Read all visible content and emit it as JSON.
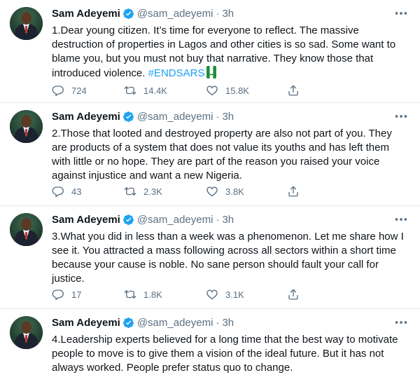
{
  "tweets": [
    {
      "name": "Sam Adeyemi",
      "handle": "@sam_adeyemi",
      "dot": "·",
      "time": "3h",
      "text": "1.Dear young citizen. It’s time for everyone to reflect. The massive destruction of properties in Lagos and other cities is so sad. Some want to blame you, but you must not buy that narrative. They know those that introduced violence.",
      "hashtag": "#ENDSARS",
      "replies": "724",
      "retweets": "14.4K",
      "likes": "15.8K"
    },
    {
      "name": "Sam Adeyemi",
      "handle": "@sam_adeyemi",
      "dot": "·",
      "time": "3h",
      "text": "2.Those that looted and destroyed property are also not part of you. They are products of a system that does not value its youths and has left them with little or no hope. They are part of the reason you raised your voice against injustice and want a new Nigeria.",
      "replies": "43",
      "retweets": "2.3K",
      "likes": "3.8K"
    },
    {
      "name": "Sam Adeyemi",
      "handle": "@sam_adeyemi",
      "dot": "·",
      "time": "3h",
      "text": "3.What you did in less than a week was a phenomenon. Let me share how I see it. You attracted a mass following across all sectors within a short time because your cause is noble. No sane person should fault your call for justice.",
      "replies": "17",
      "retweets": "1.8K",
      "likes": "3.1K"
    },
    {
      "name": "Sam Adeyemi",
      "handle": "@sam_adeyemi",
      "dot": "·",
      "time": "3h",
      "text": "4.Leadership experts believed for a long time that the best way to motivate people to move is to give them a vision of the ideal future. But it has not always worked. People prefer status quo to change."
    }
  ],
  "colors": {
    "accent": "#1da1f2",
    "muted": "#5b7083",
    "text": "#0f1419",
    "divider": "#e6ecf0"
  },
  "icons": [
    "verified-badge-icon",
    "more-options-icon",
    "reply-icon",
    "retweet-icon",
    "like-icon",
    "share-icon",
    "nigeria-flag-emoji"
  ]
}
